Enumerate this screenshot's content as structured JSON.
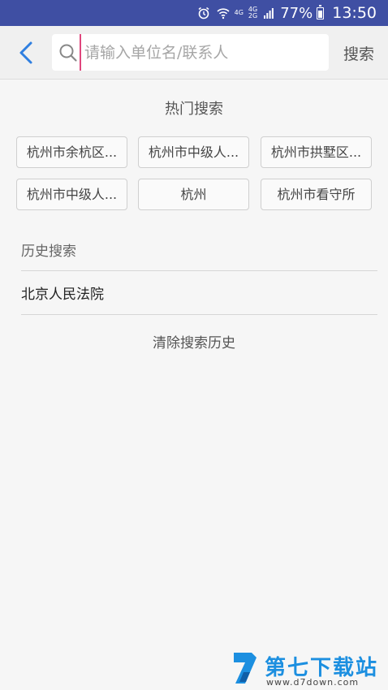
{
  "status_bar": {
    "net_top": "4G",
    "net_bottom": "2G",
    "net_lte": "4G",
    "battery": "77%",
    "time": "13:50"
  },
  "header": {
    "search_placeholder": "请输入单位名/联系人",
    "search_value": "",
    "search_button": "搜索"
  },
  "hot_search": {
    "title": "热门搜索",
    "tags": [
      "杭州市余杭区...",
      "杭州市中级人...",
      "杭州市拱墅区...",
      "杭州市中级人...",
      "杭州",
      "杭州市看守所"
    ]
  },
  "history": {
    "label": "历史搜索",
    "items": [
      "北京人民法院"
    ],
    "clear_label": "清除搜索历史"
  },
  "watermark": {
    "title": "第七下载站",
    "url": "www.d7down.com"
  },
  "colors": {
    "status_bar": "#3f4fa3",
    "accent_blue": "#2f7fe0",
    "cursor": "#e0467d",
    "background": "#f6f6f6"
  },
  "icons": [
    "alarm-icon",
    "wifi-icon",
    "signal-icon",
    "battery-icon",
    "back-arrow-icon",
    "search-icon"
  ]
}
